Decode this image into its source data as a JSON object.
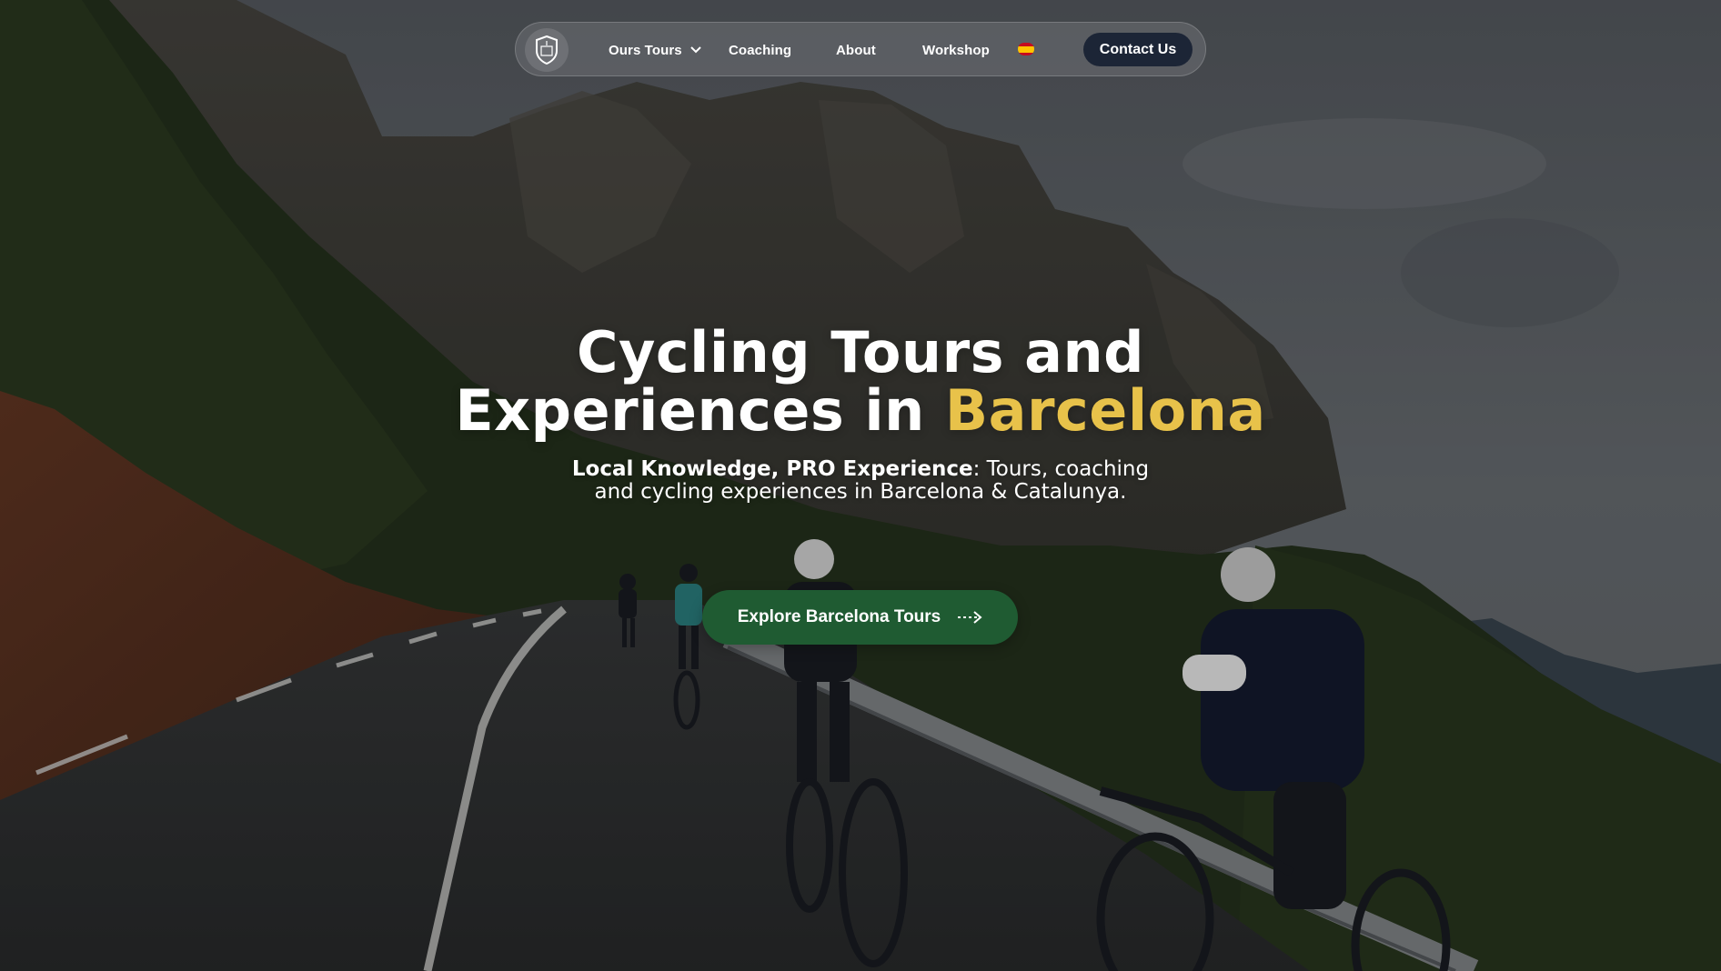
{
  "colors": {
    "accent": "#e8c24a",
    "navy": "#1c2536",
    "green": "#1f5b32",
    "flag_red": "#c60b1e",
    "flag_yellow": "#ffc400"
  },
  "nav": {
    "logo_icon": "probike-shield-logo",
    "items": [
      {
        "label": "Ours Tours",
        "has_dropdown": true
      },
      {
        "label": "Coaching"
      },
      {
        "label": "About"
      },
      {
        "label": "Workshop"
      }
    ],
    "language_icon": "spain-flag-icon",
    "contact_label": "Contact Us"
  },
  "hero": {
    "title_line1": "Cycling Tours and",
    "title_line2_prefix": "Experiences in ",
    "title_highlight": "Barcelona",
    "subtitle_bold": "Local Knowledge, PRO Experience",
    "subtitle_rest": ": Tours, coaching and cycling experiences in Barcelona & Catalunya.",
    "cta_label": "Explore Barcelona Tours",
    "cta_icon": "arrow-right-icon"
  }
}
